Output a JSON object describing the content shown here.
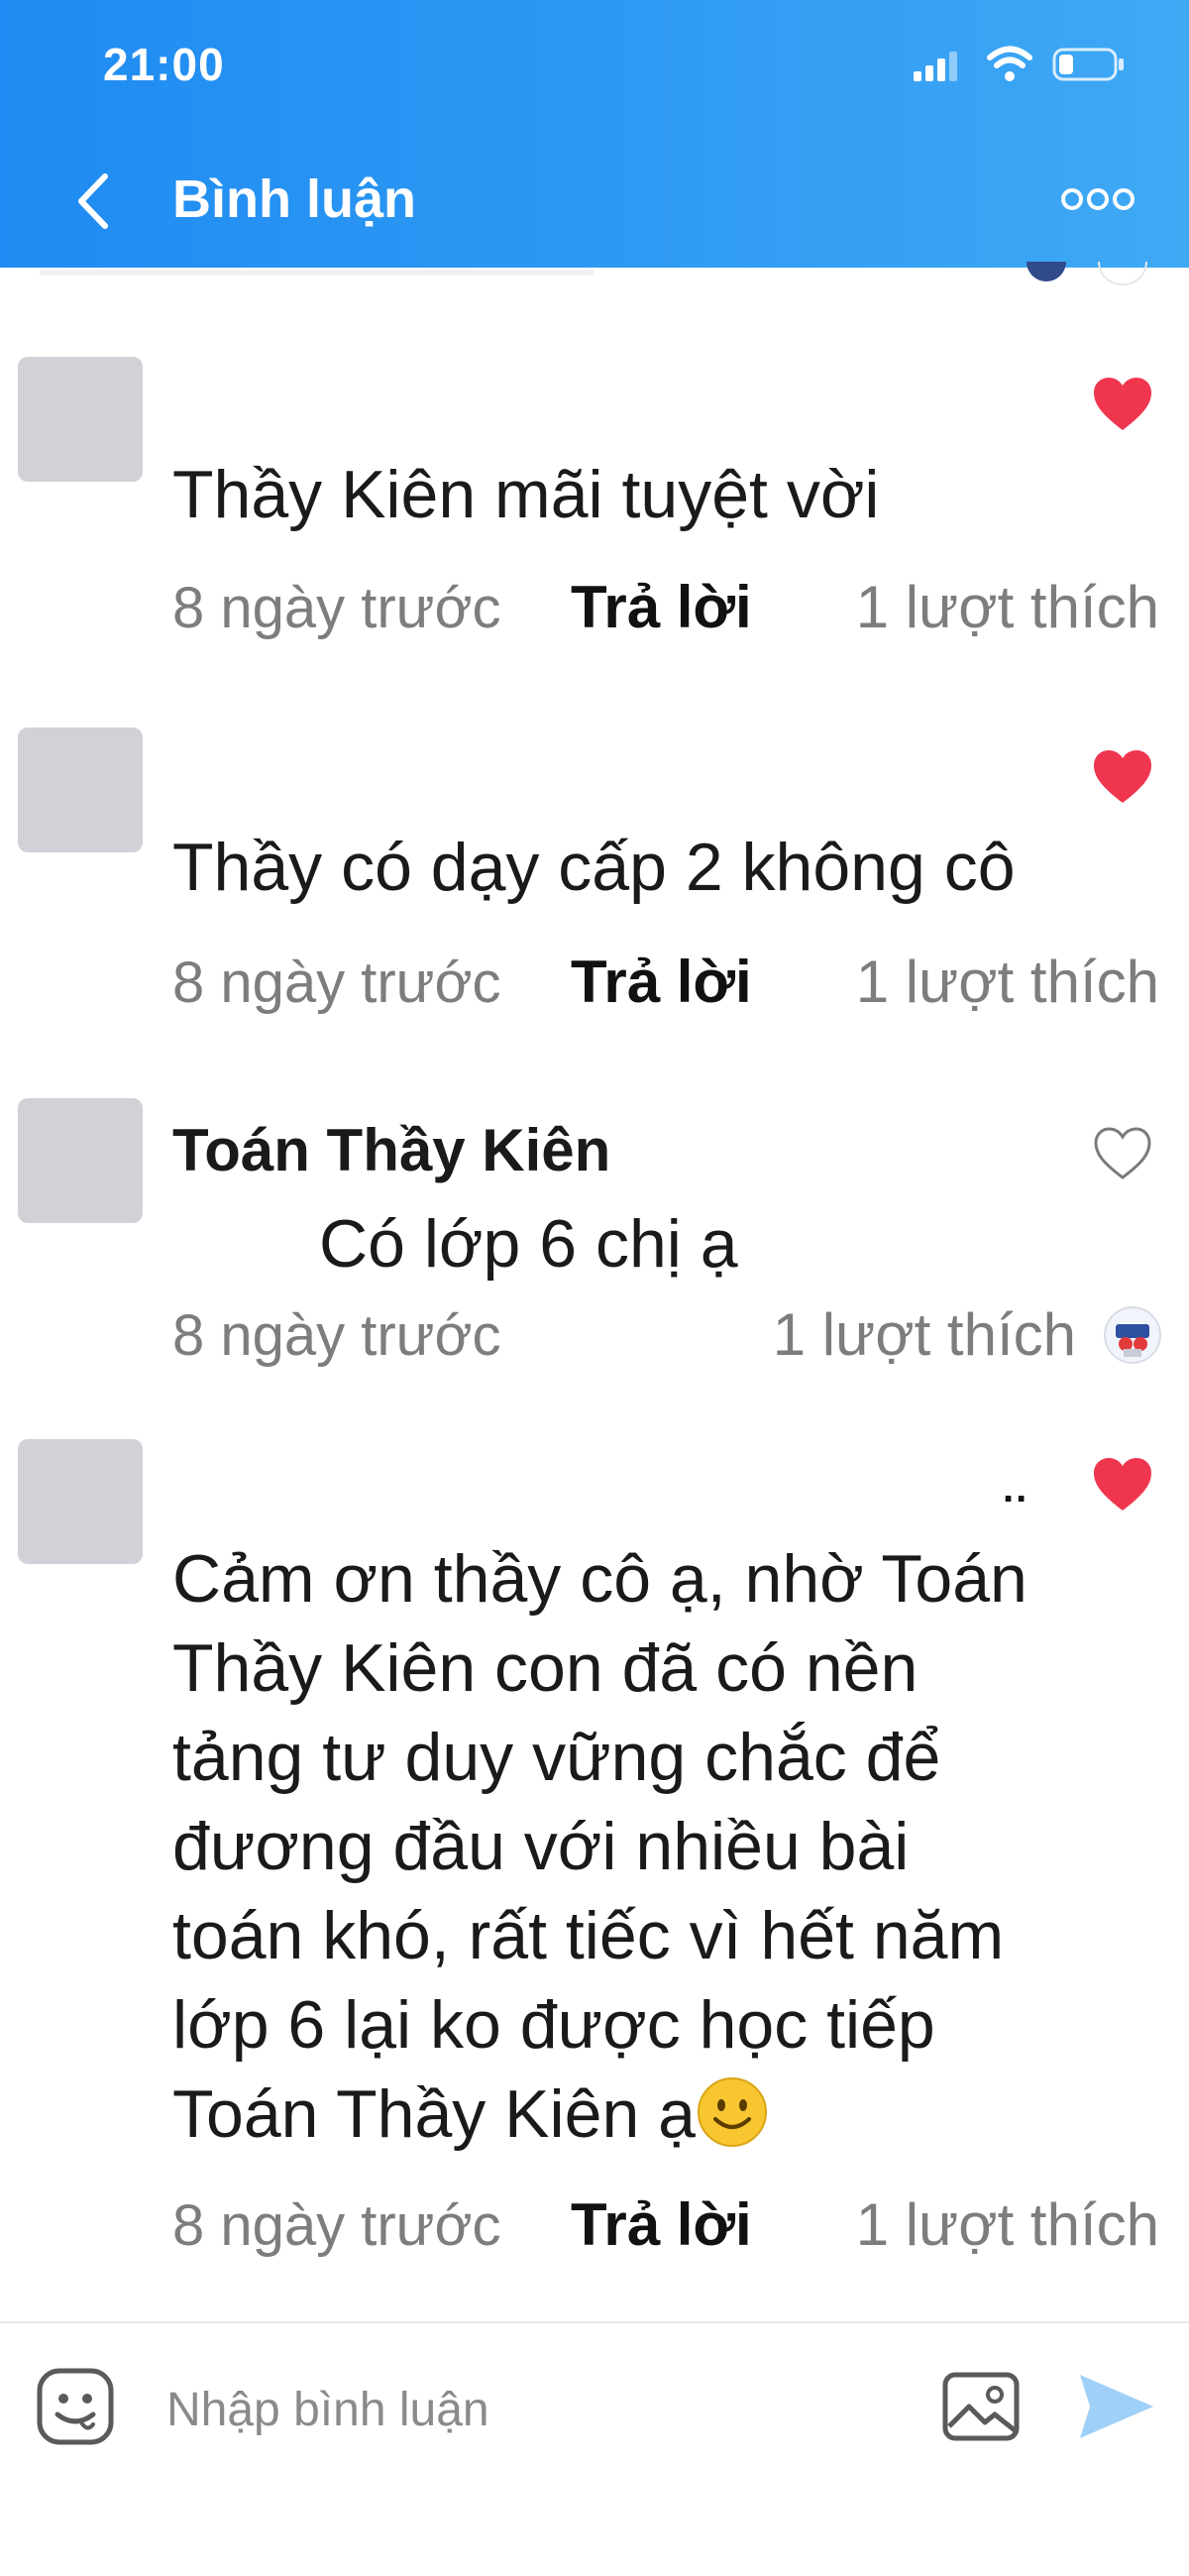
{
  "status_bar": {
    "time": "21:00"
  },
  "header": {
    "title": "Bình luận"
  },
  "comments": [
    {
      "text": "Thầy Kiên mãi tuyệt vời",
      "time": "8 ngày trước",
      "reply_label": "Trả lời",
      "likes": "1 lượt thích"
    },
    {
      "text": "Thầy có dạy cấp 2 không cô",
      "time": "8 ngày trước",
      "reply_label": "Trả lời",
      "likes": "1 lượt thích"
    },
    {
      "author": "Toán Thầy Kiên",
      "text": "Có lớp 6 chị ạ",
      "time": "8 ngày trước",
      "likes": "1 lượt thích"
    },
    {
      "lines": [
        "Cảm ơn thầy cô ạ, nhờ Toán",
        "Thầy Kiên con đã có nền",
        "tảng tư duy vững chắc để",
        "đương đầu với nhiều bài",
        "toán khó, rất tiếc vì hết năm",
        "lớp 6 lại ko được học tiếp",
        "Toán Thầy Kiên ạ"
      ],
      "more_label": "..",
      "time": "8 ngày trước",
      "reply_label": "Trả lời",
      "likes": "1 lượt thích"
    }
  ],
  "input_bar": {
    "placeholder": "Nhập bình luận"
  },
  "colors": {
    "header_start": "#1f8bf2",
    "header_end": "#3fa9f4",
    "heart": "#f0364f",
    "send": "#9fd0f8"
  }
}
